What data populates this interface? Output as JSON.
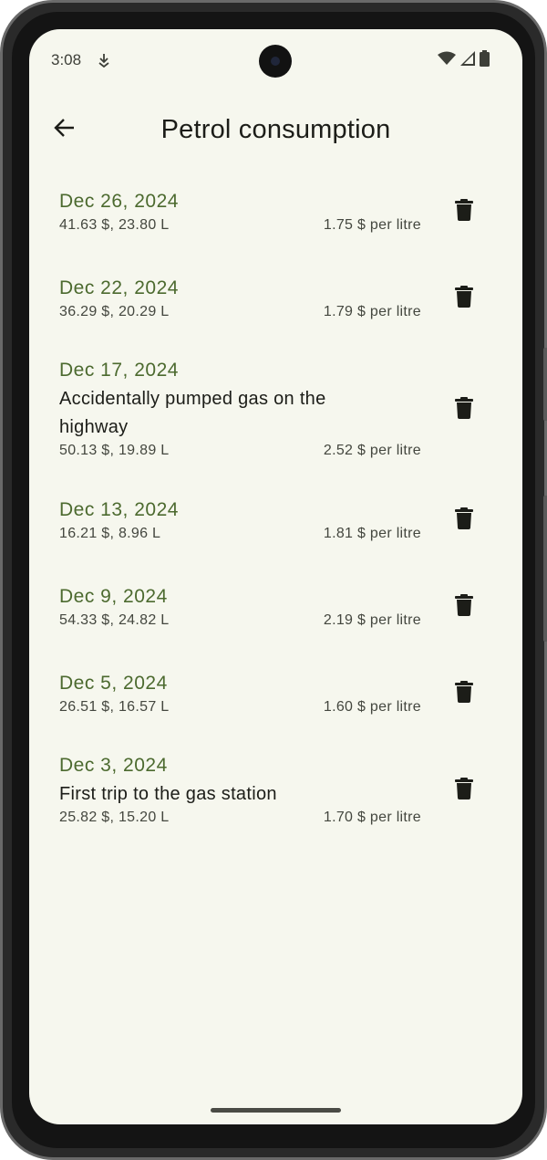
{
  "status_bar": {
    "time": "3:08",
    "icons": [
      "notification-icon",
      "wifi-icon",
      "cellular-signal-icon",
      "battery-icon"
    ]
  },
  "app_bar": {
    "title": "Petrol consumption",
    "back_icon": "arrow-back-icon"
  },
  "colors": {
    "background": "#f6f7ee",
    "date_accent": "#4c6a2f",
    "text_primary": "#1c1d18",
    "text_secondary": "#44473f"
  },
  "entries": [
    {
      "date": "Dec 26, 2024",
      "note": "",
      "amount": "41.63 $, 23.80 L",
      "rate": "1.75 $ per litre"
    },
    {
      "date": "Dec 22, 2024",
      "note": "",
      "amount": "36.29 $, 20.29 L",
      "rate": "1.79 $ per litre"
    },
    {
      "date": "Dec 17, 2024",
      "note": "Accidentally pumped gas on the highway",
      "amount": "50.13 $, 19.89 L",
      "rate": "2.52 $ per litre"
    },
    {
      "date": "Dec 13, 2024",
      "note": "",
      "amount": "16.21 $, 8.96 L",
      "rate": "1.81 $ per litre"
    },
    {
      "date": "Dec 9, 2024",
      "note": "",
      "amount": "54.33 $, 24.82 L",
      "rate": "2.19 $ per litre"
    },
    {
      "date": "Dec 5, 2024",
      "note": "",
      "amount": "26.51 $, 16.57 L",
      "rate": "1.60 $ per litre"
    },
    {
      "date": "Dec 3, 2024",
      "note": "First trip to the gas station",
      "amount": "25.82 $, 15.20 L",
      "rate": "1.70 $ per litre"
    }
  ],
  "delete_icon": "delete-icon"
}
